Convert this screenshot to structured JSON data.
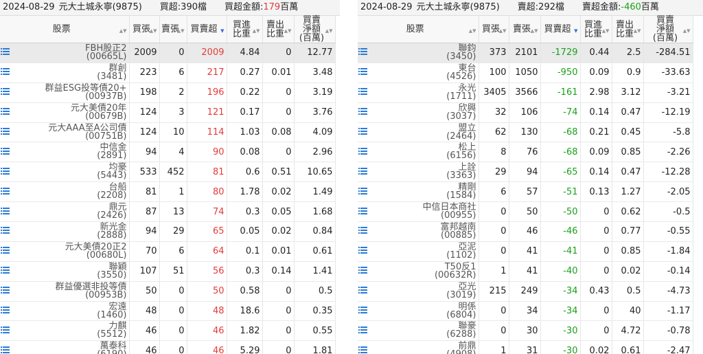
{
  "left": {
    "date": "2024-08-29",
    "broker": "元大土城永寧(9875)",
    "summary_label": "買超:390檔",
    "amount_label": "買超金額:",
    "amount_value": "179",
    "amount_unit": "百萬",
    "headers": [
      "股票",
      "買張",
      "賣張",
      "買賣超",
      "買進\n比重",
      "賣出\n比重",
      "買賣\n淨額\n(百萬)"
    ],
    "rows": [
      [
        "FBH股正2",
        "(00665L)",
        "2009",
        "0",
        "2009",
        "4.84",
        "0",
        "12.77"
      ],
      [
        "群創",
        "(3481)",
        "223",
        "6",
        "217",
        "0.27",
        "0.01",
        "3.48"
      ],
      [
        "群益ESG投等債20+",
        "(00937B)",
        "198",
        "2",
        "196",
        "0.22",
        "0",
        "3.19"
      ],
      [
        "元大美債20年",
        "(00679B)",
        "124",
        "3",
        "121",
        "0.17",
        "0",
        "3.76"
      ],
      [
        "元大AAA至A公司債",
        "(00751B)",
        "124",
        "10",
        "114",
        "1.03",
        "0.08",
        "4.09"
      ],
      [
        "中信金",
        "(2891)",
        "94",
        "4",
        "90",
        "0.08",
        "0",
        "2.96"
      ],
      [
        "均豪",
        "(5443)",
        "533",
        "452",
        "81",
        "0.6",
        "0.51",
        "10.65"
      ],
      [
        "台船",
        "(2208)",
        "81",
        "1",
        "80",
        "1.78",
        "0.02",
        "1.49"
      ],
      [
        "鼎元",
        "(2426)",
        "87",
        "13",
        "74",
        "0.3",
        "0.05",
        "1.68"
      ],
      [
        "新光金",
        "(2888)",
        "94",
        "29",
        "65",
        "0.05",
        "0.02",
        "0.84"
      ],
      [
        "元大美債20正2",
        "(00680L)",
        "70",
        "6",
        "64",
        "0.1",
        "0.01",
        "0.61"
      ],
      [
        "聯穎",
        "(3550)",
        "107",
        "51",
        "56",
        "0.3",
        "0.14",
        "1.41"
      ],
      [
        "群益優選非投等債",
        "(00953B)",
        "50",
        "0",
        "50",
        "0.58",
        "0",
        "0.5"
      ],
      [
        "宏遠",
        "(1460)",
        "48",
        "0",
        "48",
        "18.6",
        "0",
        "0.35"
      ],
      [
        "力麒",
        "(5512)",
        "46",
        "0",
        "46",
        "1.82",
        "0",
        "0.55"
      ],
      [
        "萬泰科",
        "(6190)",
        "46",
        "0",
        "46",
        "5.29",
        "0",
        "1.81"
      ]
    ]
  },
  "right": {
    "date": "2024-08-29",
    "broker": "元大土城永寧(9875)",
    "summary_label": "賣超:292檔",
    "amount_label": "賣超金額:",
    "amount_value": "-460",
    "amount_unit": "百萬",
    "headers": [
      "股票",
      "買張",
      "賣張",
      "買賣超",
      "買進\n比重",
      "賣出\n比重",
      "買賣\n淨額\n(百萬)"
    ],
    "rows": [
      [
        "聯鈞",
        "(3450)",
        "373",
        "2101",
        "-1729",
        "0.44",
        "2.5",
        "-284.51"
      ],
      [
        "東台",
        "(4526)",
        "100",
        "1050",
        "-950",
        "0.09",
        "0.9",
        "-33.63"
      ],
      [
        "永光",
        "(1711)",
        "3405",
        "3566",
        "-161",
        "2.98",
        "3.12",
        "-3.21"
      ],
      [
        "欣興",
        "(3037)",
        "32",
        "106",
        "-74",
        "0.14",
        "0.47",
        "-12.19"
      ],
      [
        "盟立",
        "(2464)",
        "62",
        "130",
        "-68",
        "0.21",
        "0.45",
        "-5.8"
      ],
      [
        "松上",
        "(6156)",
        "8",
        "76",
        "-68",
        "0.09",
        "0.85",
        "-2.26"
      ],
      [
        "上詮",
        "(3363)",
        "29",
        "94",
        "-65",
        "0.14",
        "0.47",
        "-12.28"
      ],
      [
        "精剛",
        "(1584)",
        "6",
        "57",
        "-51",
        "0.13",
        "1.27",
        "-2.05"
      ],
      [
        "中信日本商社",
        "(00955)",
        "0",
        "50",
        "-50",
        "0",
        "0.62",
        "-0.5"
      ],
      [
        "富邦越南",
        "(00885)",
        "0",
        "46",
        "-46",
        "0",
        "0.77",
        "-0.55"
      ],
      [
        "亞泥",
        "(1102)",
        "0",
        "41",
        "-41",
        "0",
        "0.85",
        "-1.84"
      ],
      [
        "T50反1",
        "(00632R)",
        "1",
        "41",
        "-40",
        "0",
        "0.02",
        "-0.14"
      ],
      [
        "亞光",
        "(3019)",
        "215",
        "249",
        "-34",
        "0.43",
        "0.5",
        "-4.73"
      ],
      [
        "明係",
        "(6804)",
        "0",
        "34",
        "-34",
        "0",
        "40",
        "-1.17"
      ],
      [
        "聯豪",
        "(6288)",
        "0",
        "30",
        "-30",
        "0",
        "4.72",
        "-0.78"
      ],
      [
        "前鼎",
        "(4908)",
        "1",
        "31",
        "-30",
        "0.02",
        "0.61",
        "-2.47"
      ]
    ]
  },
  "colors": {
    "positive": "#e23b3b",
    "negative": "#1aa11a",
    "icon": "#2a7ad6"
  },
  "icons": {
    "row_icon": "list-menu-icon",
    "sort_icon": "sort-arrows-icon"
  }
}
